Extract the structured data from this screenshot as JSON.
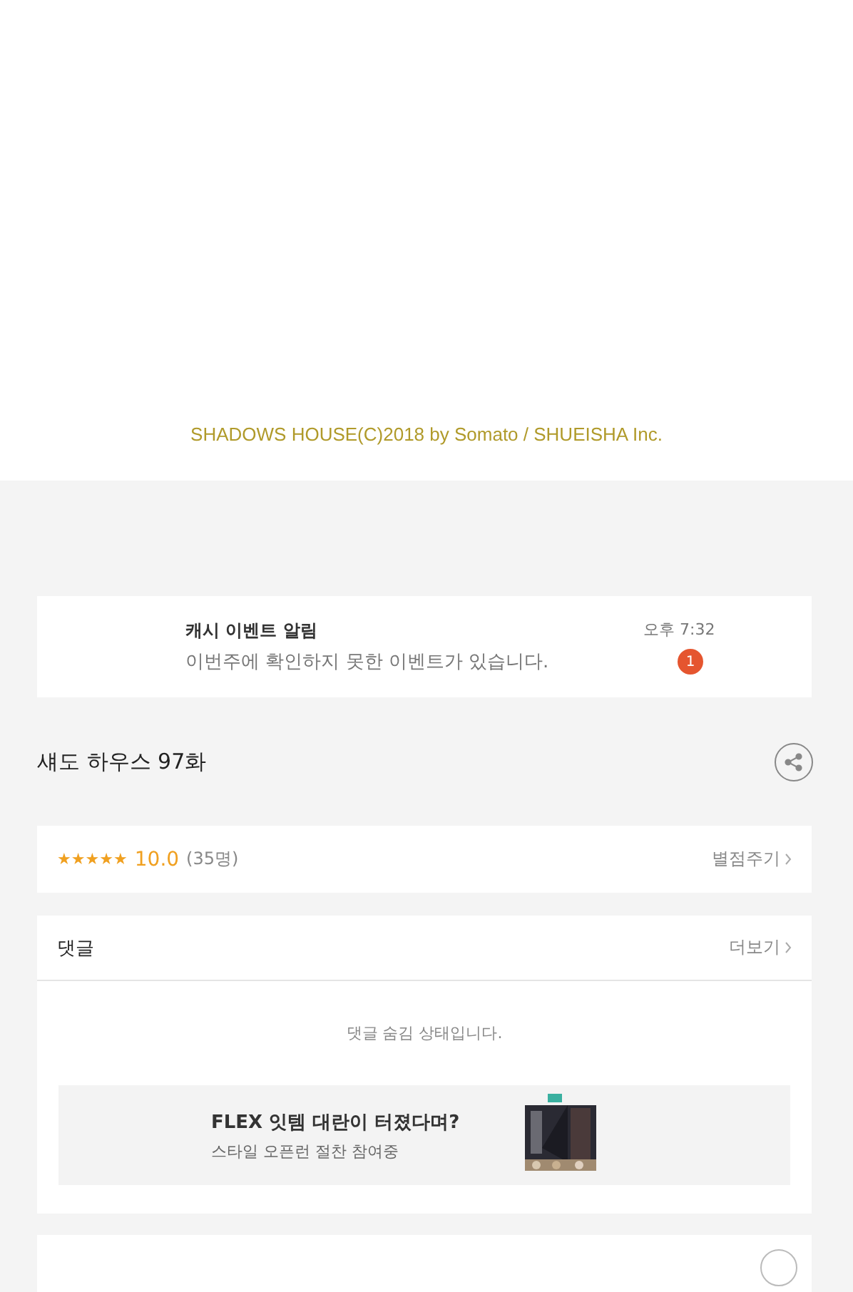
{
  "copyright": "SHADOWS HOUSE(C)2018 by Somato / SHUEISHA Inc.",
  "notice": {
    "title": "캐시 이벤트 알림",
    "message": "이번주에 확인하지 못한 이벤트가 있습니다.",
    "time": "오후 7:32",
    "badge": "1"
  },
  "episode": {
    "title": "섀도 하우스 97화"
  },
  "rating": {
    "stars": 5,
    "score": "10.0",
    "count": "(35명)",
    "action": "별점주기"
  },
  "comments": {
    "title": "댓글",
    "more": "더보기",
    "status": "댓글 숨김 상태입니다."
  },
  "ad": {
    "title": "FLEX 잇템 대란이 터졌다며?",
    "subtitle": "스타일 오픈런 절찬 참여중"
  }
}
